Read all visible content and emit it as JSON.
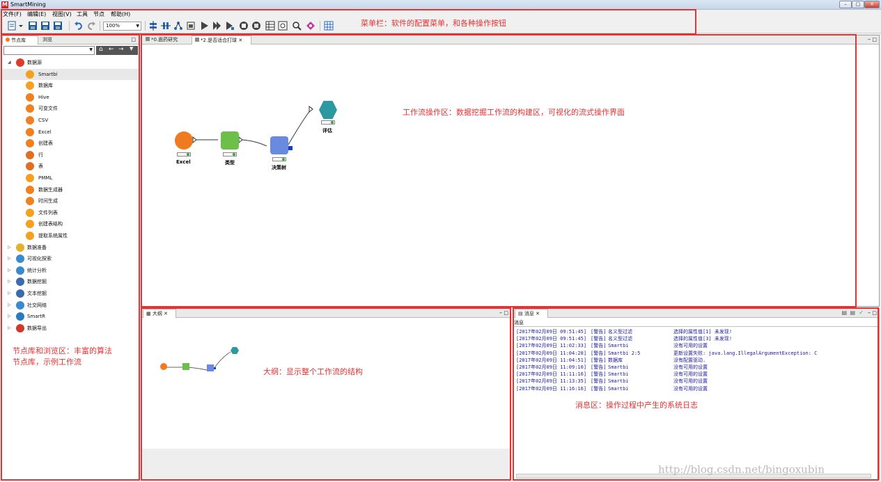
{
  "window": {
    "title": "SmartMining",
    "logo": "M"
  },
  "menu": [
    "文件(F)",
    "编辑(E)",
    "视图(V)",
    "工具",
    "节点",
    "帮助(H)"
  ],
  "toolbar": {
    "zoom": "100%"
  },
  "left_panel": {
    "tabs": [
      "节点库",
      "浏览"
    ],
    "tree": [
      {
        "label": "数据源",
        "expanded": true,
        "level": 0,
        "color": "#e03a2a"
      },
      {
        "label": "Smartbi",
        "level": 1,
        "color": "#f4a020"
      },
      {
        "label": "数据库",
        "level": 1,
        "color": "#f4a020"
      },
      {
        "label": "Hive",
        "level": 1,
        "color": "#f08020"
      },
      {
        "label": "可变文件",
        "level": 1,
        "color": "#f08020"
      },
      {
        "label": "CSV",
        "level": 1,
        "color": "#f08020"
      },
      {
        "label": "Excel",
        "level": 1,
        "color": "#f08020"
      },
      {
        "label": "创建表",
        "level": 1,
        "color": "#f08020"
      },
      {
        "label": "行",
        "level": 1,
        "color": "#e07020"
      },
      {
        "label": "表",
        "level": 1,
        "color": "#e07020"
      },
      {
        "label": "PMML",
        "level": 1,
        "color": "#f4a020"
      },
      {
        "label": "数据生成器",
        "level": 1,
        "color": "#f08020"
      },
      {
        "label": "时间生成",
        "level": 1,
        "color": "#f08020"
      },
      {
        "label": "文件列表",
        "level": 1,
        "color": "#f4a020"
      },
      {
        "label": "创建表结构",
        "level": 1,
        "color": "#f4a020"
      },
      {
        "label": "提取系统属性",
        "level": 1,
        "color": "#f4a020"
      },
      {
        "label": "数据准备",
        "level": 0,
        "color": "#e0b030"
      },
      {
        "label": "可视化探索",
        "level": 0,
        "color": "#3a8ad0"
      },
      {
        "label": "统计分析",
        "level": 0,
        "color": "#3a8ad0"
      },
      {
        "label": "数据挖掘",
        "level": 0,
        "color": "#3a6ab0"
      },
      {
        "label": "文本挖掘",
        "level": 0,
        "color": "#3a6ab0"
      },
      {
        "label": "社交网络",
        "level": 0,
        "color": "#3a8ad0"
      },
      {
        "label": "SmartR",
        "level": 0,
        "color": "#2a7ac0"
      },
      {
        "label": "数据导出",
        "level": 0,
        "color": "#d03a2a"
      }
    ]
  },
  "workflow": {
    "tabs": [
      "*0.面药研究",
      "*2.是否适合打球"
    ],
    "nodes": [
      {
        "label": "Excel",
        "color": "#f07a20"
      },
      {
        "label": "类型",
        "color": "#6cc04a"
      },
      {
        "label": "决策树",
        "color": "#6a8ae0"
      },
      {
        "label": "评估",
        "color": "#2a9aa0"
      }
    ]
  },
  "outline": {
    "title": "大纲"
  },
  "messages": {
    "title": "消息",
    "header": "消息",
    "logs": [
      {
        "time": "[2017年02月09日 09:51:45]",
        "level": "[警告]",
        "source": "名义型过滤",
        "message": "选择的属性值[1] 未发现!"
      },
      {
        "time": "[2017年02月09日 09:51:45]",
        "level": "[警告]",
        "source": "名义型过滤",
        "message": "选择的属性值[3] 未发现!"
      },
      {
        "time": "[2017年02月09日 11:02:33]",
        "level": "[警告]",
        "source": "Smartbi",
        "message": "没有可用的设置"
      },
      {
        "time": "[2017年02月09日 11:04:28]",
        "level": "[警告]",
        "source": "Smartbi 2:5",
        "message": "更新设置失败: java.lang.IllegalArgumentException: C"
      },
      {
        "time": "[2017年02月09日 11:04:51]",
        "level": "[警告]",
        "source": "数据库",
        "message": "没有配置驱动."
      },
      {
        "time": "[2017年02月09日 11:09:10]",
        "level": "[警告]",
        "source": "Smartbi",
        "message": "没有可用的设置"
      },
      {
        "time": "[2017年02月09日 11:11:16]",
        "level": "[警告]",
        "source": "Smartbi",
        "message": "没有可用的设置"
      },
      {
        "time": "[2017年02月09日 11:13:35]",
        "level": "[警告]",
        "source": "Smartbi",
        "message": "没有可用的设置"
      },
      {
        "time": "[2017年02月09日 11:16:16]",
        "level": "[警告]",
        "source": "Smartbi",
        "message": "没有可用的设置"
      }
    ]
  },
  "annotations": {
    "menubar": "菜单栏：软件的配置菜单，和各种操作按钮",
    "workflow": "工作流操作区：数据挖掘工作流的构建区，可视化的流式操作界面",
    "left_line1": "节点库和浏览区：丰富的算法",
    "left_line2": "节点库，示例工作流",
    "outline": "大纲：显示整个工作流的结构",
    "messages": "消息区：操作过程中产生的系统日志"
  },
  "watermark": "http://blog.csdn.net/bingoxubin"
}
